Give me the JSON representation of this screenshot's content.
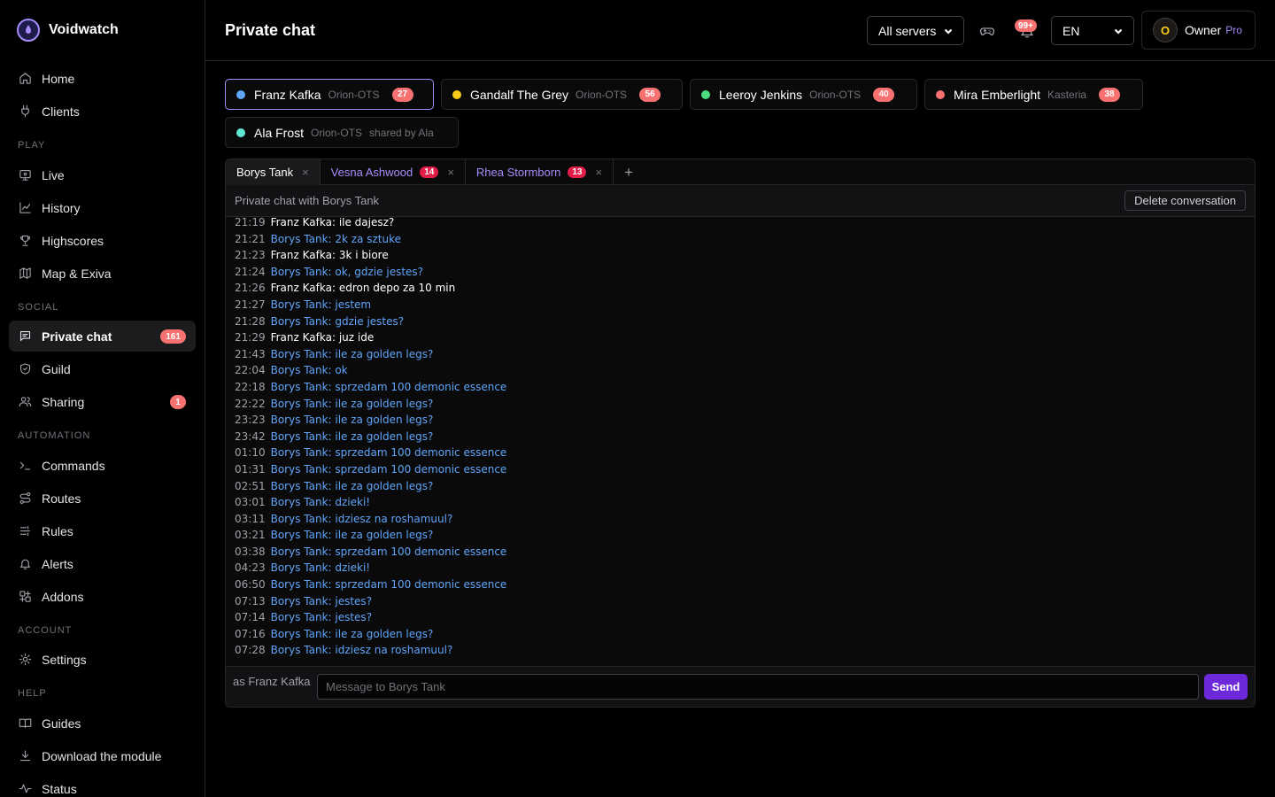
{
  "app": {
    "name": "Voidwatch"
  },
  "sidebar": {
    "sections": {
      "play": "PLAY",
      "social": "SOCIAL",
      "automation": "AUTOMATION",
      "account": "ACCOUNT",
      "help": "HELP"
    },
    "items": {
      "home": "Home",
      "clients": "Clients",
      "live": "Live",
      "history": "History",
      "highscores": "Highscores",
      "map": "Map & Exiva",
      "private_chat": "Private chat",
      "private_chat_badge": "161",
      "guild": "Guild",
      "sharing": "Sharing",
      "sharing_badge": "1",
      "commands": "Commands",
      "routes": "Routes",
      "rules": "Rules",
      "alerts": "Alerts",
      "addons": "Addons",
      "settings": "Settings",
      "guides": "Guides",
      "download": "Download the module",
      "status": "Status"
    }
  },
  "header": {
    "title": "Private chat",
    "server_select": "All servers",
    "notif_badge": "99+",
    "language": "EN",
    "user": {
      "initial": "O",
      "name": "Owner",
      "plan": "Pro"
    }
  },
  "characters": [
    {
      "name": "Franz Kafka",
      "server": "Orion-OTS",
      "badge": "27",
      "color": "#60a5fa"
    },
    {
      "name": "Gandalf The Grey",
      "server": "Orion-OTS",
      "badge": "56",
      "color": "#facc15"
    },
    {
      "name": "Leeroy Jenkins",
      "server": "Orion-OTS",
      "badge": "40",
      "color": "#4ade80"
    },
    {
      "name": "Mira Emberlight",
      "server": "Kasteria",
      "badge": "38",
      "color": "#f87171"
    },
    {
      "name": "Ala Frost",
      "server": "Orion-OTS",
      "shared": "shared by Ala",
      "color": "#5eead4"
    }
  ],
  "chat": {
    "tabs": [
      {
        "name": "Borys Tank",
        "close": "×"
      },
      {
        "name": "Vesna Ashwood",
        "badge": "14",
        "close": "×"
      },
      {
        "name": "Rhea Stormborn",
        "badge": "13",
        "close": "×"
      }
    ],
    "add_tab": "+",
    "subtitle": "Private chat with Borys Tank",
    "delete_label": "Delete conversation",
    "messages": [
      {
        "time": "21:19",
        "text": "Franz Kafka: ile dajesz?",
        "me": true
      },
      {
        "time": "21:21",
        "text": "Borys Tank: 2k za sztuke",
        "me": false
      },
      {
        "time": "21:23",
        "text": "Franz Kafka: 3k i biore",
        "me": true
      },
      {
        "time": "21:24",
        "text": "Borys Tank: ok, gdzie jestes?",
        "me": false
      },
      {
        "time": "21:26",
        "text": "Franz Kafka: edron depo za 10 min",
        "me": true
      },
      {
        "time": "21:27",
        "text": "Borys Tank: jestem",
        "me": false
      },
      {
        "time": "21:28",
        "text": "Borys Tank: gdzie jestes?",
        "me": false
      },
      {
        "time": "21:29",
        "text": "Franz Kafka: juz ide",
        "me": true
      },
      {
        "time": "21:43",
        "text": "Borys Tank: ile za golden legs?",
        "me": false
      },
      {
        "time": "22:04",
        "text": "Borys Tank: ok",
        "me": false
      },
      {
        "time": "22:18",
        "text": "Borys Tank: sprzedam 100 demonic essence",
        "me": false
      },
      {
        "time": "22:22",
        "text": "Borys Tank: ile za golden legs?",
        "me": false
      },
      {
        "time": "23:23",
        "text": "Borys Tank: ile za golden legs?",
        "me": false
      },
      {
        "time": "23:42",
        "text": "Borys Tank: ile za golden legs?",
        "me": false
      },
      {
        "time": "01:10",
        "text": "Borys Tank: sprzedam 100 demonic essence",
        "me": false
      },
      {
        "time": "01:31",
        "text": "Borys Tank: sprzedam 100 demonic essence",
        "me": false
      },
      {
        "time": "02:51",
        "text": "Borys Tank: ile za golden legs?",
        "me": false
      },
      {
        "time": "03:01",
        "text": "Borys Tank: dzieki!",
        "me": false
      },
      {
        "time": "03:11",
        "text": "Borys Tank: idziesz na roshamuul?",
        "me": false
      },
      {
        "time": "03:21",
        "text": "Borys Tank: ile za golden legs?",
        "me": false
      },
      {
        "time": "03:38",
        "text": "Borys Tank: sprzedam 100 demonic essence",
        "me": false
      },
      {
        "time": "04:23",
        "text": "Borys Tank: dzieki!",
        "me": false
      },
      {
        "time": "06:50",
        "text": "Borys Tank: sprzedam 100 demonic essence",
        "me": false
      },
      {
        "time": "07:13",
        "text": "Borys Tank: jestes?",
        "me": false
      },
      {
        "time": "07:14",
        "text": "Borys Tank: jestes?",
        "me": false
      },
      {
        "time": "07:16",
        "text": "Borys Tank: ile za golden legs?",
        "me": false
      },
      {
        "time": "07:28",
        "text": "Borys Tank: idziesz na roshamuul?",
        "me": false
      }
    ],
    "composer": {
      "as_label": "as Franz Kafka",
      "placeholder": "Message to Borys Tank",
      "value": "",
      "send_label": "Send"
    }
  }
}
